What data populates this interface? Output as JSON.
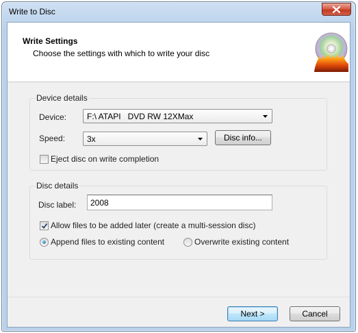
{
  "window": {
    "title": "Write to Disc"
  },
  "header": {
    "title": "Write Settings",
    "subtitle": "Choose the settings with which to write your disc",
    "icon": "disc-burn-icon"
  },
  "device_details": {
    "group_label": "Device details",
    "device_label": "Device:",
    "device_value": "F:\\ ATAPI   DVD RW 12XMax",
    "speed_label": "Speed:",
    "speed_value": "3x",
    "disc_info_label": "Disc info...",
    "eject_label": "Eject disc on write completion",
    "eject_checked": false
  },
  "disc_details": {
    "group_label": "Disc details",
    "disc_label_label": "Disc label:",
    "disc_label_value": "2008",
    "allow_label": "Allow files to be added later (create a multi-session disc)",
    "allow_checked": true,
    "append_label": "Append files to existing content",
    "append_selected": true,
    "overwrite_label": "Overwrite existing content",
    "overwrite_selected": false
  },
  "footer": {
    "next_label": "Next >",
    "cancel_label": "Cancel"
  }
}
